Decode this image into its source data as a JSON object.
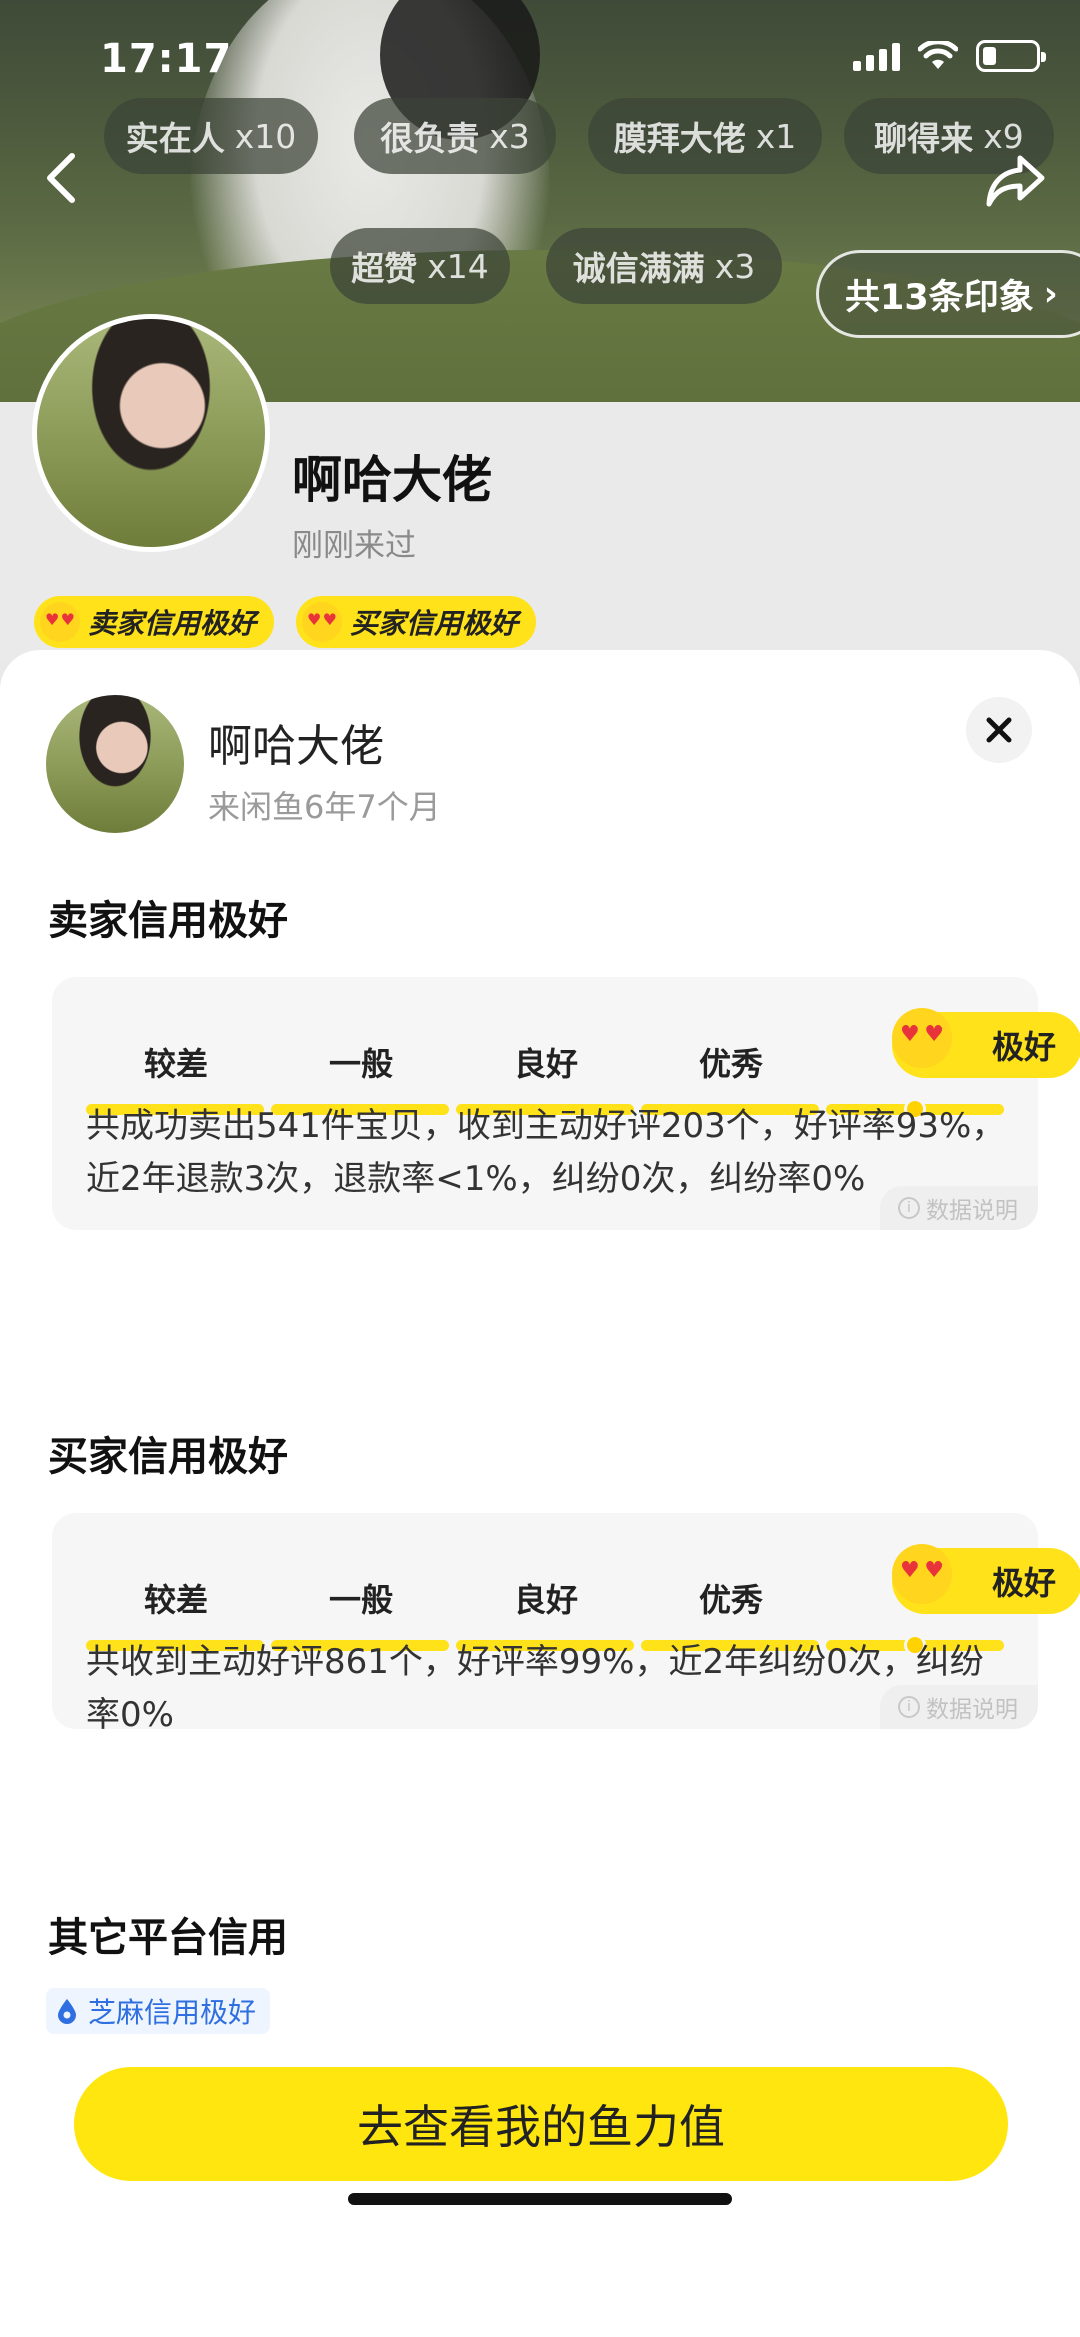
{
  "status_bar": {
    "time": "17:17",
    "battery_percent": 26
  },
  "impressions": {
    "tags": [
      {
        "label": "实在人",
        "count": "x10"
      },
      {
        "label": "很负责",
        "count": "x3"
      },
      {
        "label": "膜拜大佬",
        "count": "x1"
      },
      {
        "label": "聊得来",
        "count": "x9"
      },
      {
        "label": "超赞",
        "count": "x14"
      },
      {
        "label": "诚信满满",
        "count": "x3"
      }
    ],
    "total_button": "共13条印象",
    "chevron": "›"
  },
  "profile": {
    "name": "啊哈大佬",
    "last_seen": "刚刚来过",
    "badges": [
      "卖家信用极好",
      "买家信用极好"
    ]
  },
  "sheet": {
    "name": "啊哈大佬",
    "member_since": "来闲鱼6年7个月",
    "level_labels": [
      "较差",
      "一般",
      "良好",
      "优秀",
      "极好"
    ],
    "seller": {
      "title": "卖家信用极好",
      "current_level": "极好",
      "description": "共成功卖出541件宝贝，收到主动好评203个，好评率93%，近2年退款3次，退款率<1%，纠纷0次，纠纷率0%",
      "data_note": "数据说明"
    },
    "buyer": {
      "title": "买家信用极好",
      "current_level": "极好",
      "description": "共收到主动好评861个，好评率99%，近2年纠纷0次，纠纷率0%",
      "data_note": "数据说明"
    },
    "other": {
      "title": "其它平台信用",
      "zhima_label": "芝麻信用极好"
    },
    "cta": "去查看我的鱼力值"
  },
  "colors": {
    "accent": "#FFE21A",
    "cta": "#FFE60F",
    "zhima_blue": "#2F6FE0"
  }
}
